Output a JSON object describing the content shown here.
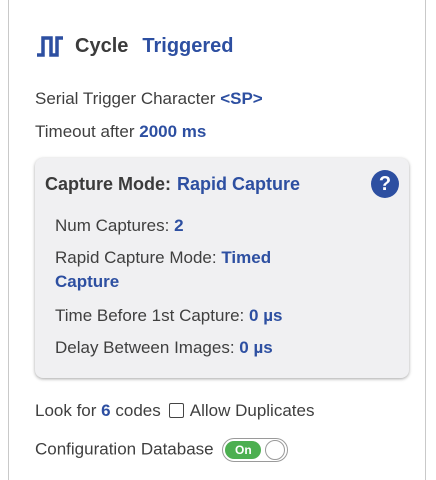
{
  "header": {
    "title": "Cycle",
    "mode": "Triggered",
    "icon": "pulse-icon"
  },
  "serial_trigger": {
    "label": "Serial Trigger Character",
    "value": "<SP>"
  },
  "timeout": {
    "label": "Timeout after",
    "value": "2000 ms"
  },
  "capture": {
    "label": "Capture Mode:",
    "value": "Rapid Capture",
    "help_icon": "?",
    "num_captures": {
      "label": "Num Captures:",
      "value": "2"
    },
    "rapid_mode": {
      "label": "Rapid Capture Mode:",
      "value_line1": "Timed",
      "value_line2": "Capture"
    },
    "time_before": {
      "label": "Time Before 1st Capture:",
      "value": "0 µs"
    },
    "delay_between": {
      "label": "Delay Between Images:",
      "value": "0 µs"
    }
  },
  "lookfor": {
    "prefix": "Look for",
    "count": "6",
    "suffix": "codes",
    "allow_duplicates_label": "Allow Duplicates",
    "allow_duplicates_checked": false
  },
  "config_db": {
    "label": "Configuration Database",
    "toggle_label": "On",
    "toggle_state": "on"
  },
  "colors": {
    "accent": "#2d4fa1",
    "toggle_on": "#4caf50",
    "box_bg": "#f0f0f2"
  }
}
